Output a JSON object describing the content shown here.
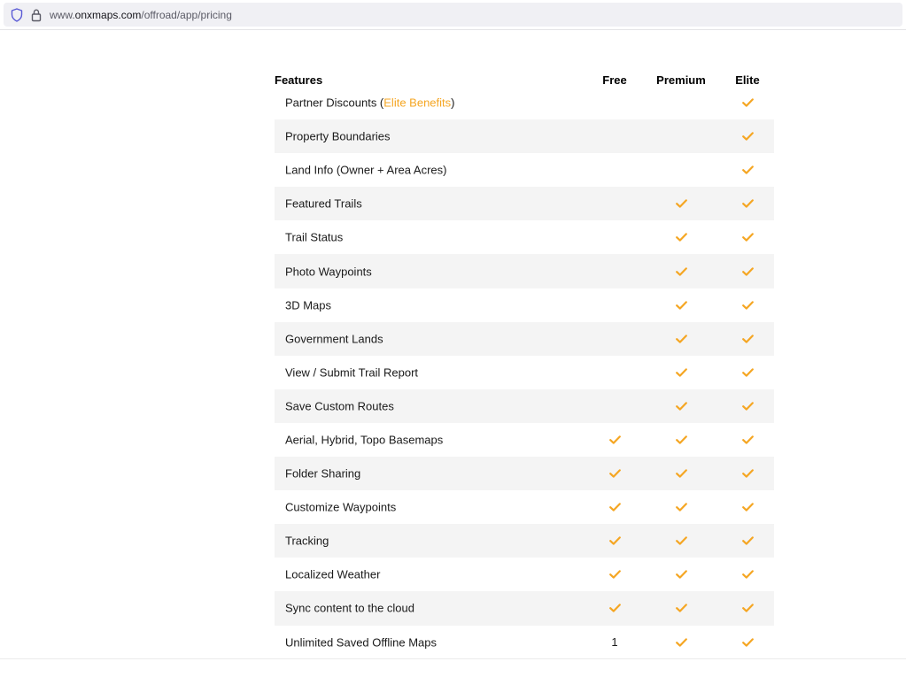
{
  "browser": {
    "url_prefix": "www.",
    "url_host": "onxmaps.com",
    "url_path": "/offroad/app/pricing"
  },
  "table": {
    "headers": {
      "feature": "Features",
      "free": "Free",
      "premium": "Premium",
      "elite": "Elite"
    },
    "first_row": {
      "label_before": "Partner Discounts (",
      "link_text": "Elite Benefits",
      "label_after": ")"
    },
    "rows": [
      {
        "label": "Partner Discounts (Elite Benefits)",
        "free": "",
        "premium": "",
        "elite": "check"
      },
      {
        "label": "Property Boundaries",
        "free": "",
        "premium": "",
        "elite": "check"
      },
      {
        "label": "Land Info (Owner + Area Acres)",
        "free": "",
        "premium": "",
        "elite": "check"
      },
      {
        "label": "Featured Trails",
        "free": "",
        "premium": "check",
        "elite": "check"
      },
      {
        "label": "Trail Status",
        "free": "",
        "premium": "check",
        "elite": "check"
      },
      {
        "label": "Photo Waypoints",
        "free": "",
        "premium": "check",
        "elite": "check"
      },
      {
        "label": "3D Maps",
        "free": "",
        "premium": "check",
        "elite": "check"
      },
      {
        "label": "Government Lands",
        "free": "",
        "premium": "check",
        "elite": "check"
      },
      {
        "label": "View / Submit Trail Report",
        "free": "",
        "premium": "check",
        "elite": "check"
      },
      {
        "label": "Save Custom Routes",
        "free": "",
        "premium": "check",
        "elite": "check"
      },
      {
        "label": "Aerial, Hybrid, Topo Basemaps",
        "free": "check",
        "premium": "check",
        "elite": "check"
      },
      {
        "label": "Folder Sharing",
        "free": "check",
        "premium": "check",
        "elite": "check"
      },
      {
        "label": "Customize Waypoints",
        "free": "check",
        "premium": "check",
        "elite": "check"
      },
      {
        "label": "Tracking",
        "free": "check",
        "premium": "check",
        "elite": "check"
      },
      {
        "label": "Localized Weather",
        "free": "check",
        "premium": "check",
        "elite": "check"
      },
      {
        "label": "Sync content to the cloud",
        "free": "check",
        "premium": "check",
        "elite": "check"
      },
      {
        "label": "Unlimited Saved Offline Maps",
        "free": "1",
        "premium": "check",
        "elite": "check"
      }
    ]
  },
  "colors": {
    "check": "#f5a623",
    "link": "#f5a623",
    "row_shade": "#f4f4f4"
  },
  "icons": {
    "shield": "shield-icon",
    "lock": "lock-icon",
    "check": "check-icon"
  }
}
